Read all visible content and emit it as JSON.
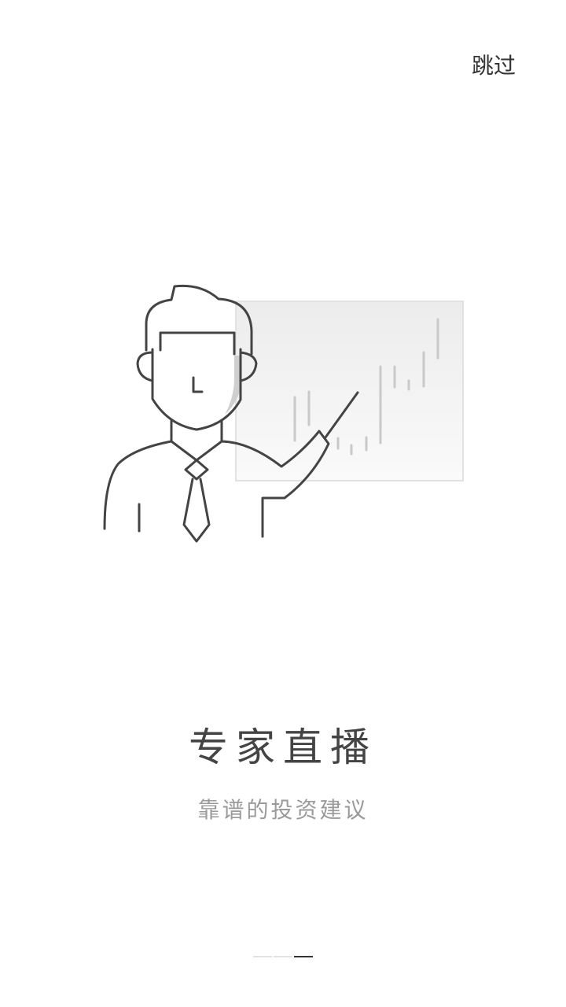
{
  "header": {
    "skip_label": "跳过"
  },
  "slide": {
    "illustration_icon": "presenter-with-chart-icon",
    "title": "专家直播",
    "subtitle": "靠谱的投资建议"
  },
  "pager": {
    "total": 3,
    "current": 3
  },
  "colors": {
    "background": "#ffffff",
    "title": "#444444",
    "subtitle": "#9a9a9a",
    "line": "#444444",
    "active_dot": "#333333",
    "inactive_dot": "#e3e3e3"
  }
}
